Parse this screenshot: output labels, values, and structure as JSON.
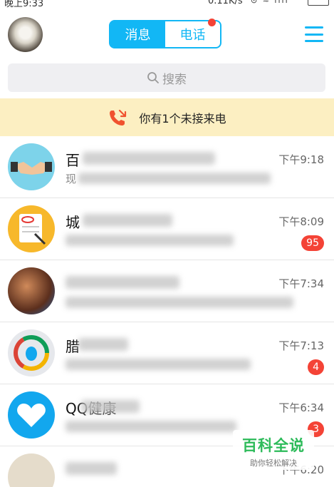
{
  "status_bar": {
    "time": "晚上9:33",
    "speed": "0.11K/s"
  },
  "header": {
    "tabs": [
      {
        "label": "消息",
        "active": true
      },
      {
        "label": "电话",
        "active": false,
        "has_dot": true
      }
    ]
  },
  "search": {
    "placeholder": "搜索"
  },
  "missed_call": {
    "text": "你有1个未接来电"
  },
  "conversations": [
    {
      "name": "百",
      "preview": "现",
      "time": "下午9:18",
      "badge": ""
    },
    {
      "name": "城",
      "preview": "",
      "time": "下午8:09",
      "badge": "95"
    },
    {
      "name": "",
      "preview": "",
      "time": "下午7:34",
      "badge": ""
    },
    {
      "name": "腊",
      "preview": "",
      "time": "下午7:13",
      "badge": "4"
    },
    {
      "name": "QQ健康",
      "preview": "",
      "time": "下午6:34",
      "badge": "3"
    },
    {
      "name": "",
      "preview": "",
      "time": "下午6:20",
      "badge": ""
    }
  ],
  "watermark": {
    "title": "百科全说",
    "subtitle": "助你轻松解决"
  },
  "colors": {
    "accent": "#12b7f5",
    "badge": "#f44336",
    "banner": "#fcefc2",
    "missed_icon": "#f0522f"
  }
}
